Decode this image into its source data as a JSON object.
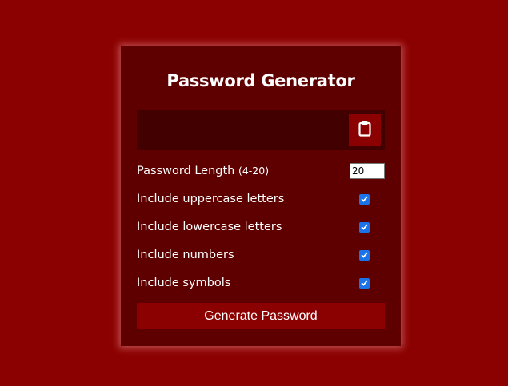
{
  "app": {
    "title": "Password Generator"
  },
  "result": {
    "value": "",
    "copy_icon": "clipboard-icon"
  },
  "settings": {
    "length": {
      "label": "Password Length",
      "hint": "(4-20)",
      "value": "20"
    },
    "uppercase": {
      "label": "Include uppercase letters",
      "checked": true
    },
    "lowercase": {
      "label": "Include lowercase letters",
      "checked": true
    },
    "numbers": {
      "label": "Include numbers",
      "checked": true
    },
    "symbols": {
      "label": "Include symbols",
      "checked": true
    }
  },
  "actions": {
    "generate_label": "Generate Password"
  },
  "colors": {
    "page_background": "#8b0000",
    "card_background": "#5e0000",
    "result_background": "#420000",
    "button_background": "#8b0000",
    "checkbox_accent": "#1a73e8"
  }
}
